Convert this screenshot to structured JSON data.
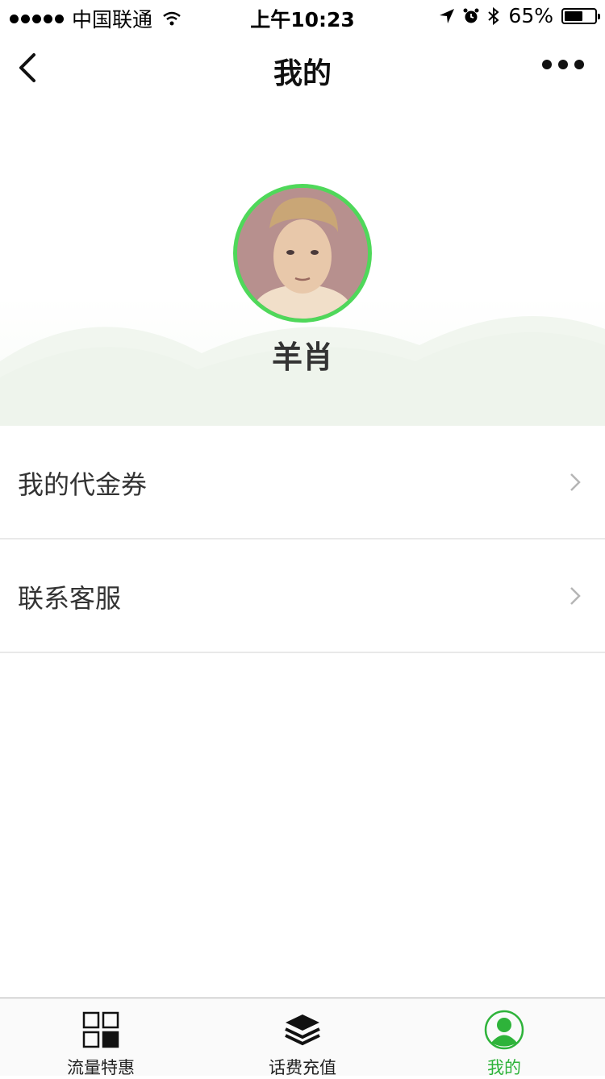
{
  "status_bar": {
    "carrier": "中国联通",
    "time": "上午10:23",
    "battery": "65%",
    "battery_level": 0.65,
    "icons": [
      "signal-dots",
      "wifi-icon",
      "location-arrow-icon",
      "alarm-icon",
      "bluetooth-icon",
      "battery-icon"
    ]
  },
  "nav": {
    "title": "我的",
    "back_icon": "chevron-left-icon",
    "more_icon": "more-dots-icon"
  },
  "profile": {
    "name": "羊肖",
    "avatar": "avatar-photo",
    "ring_color": "#4fd85a"
  },
  "menu": {
    "items": [
      {
        "label": "我的代金券",
        "icon": "chevron-right-icon"
      },
      {
        "label": "联系客服",
        "icon": "chevron-right-icon"
      }
    ]
  },
  "tabs": [
    {
      "label": "流量特惠",
      "icon": "grid-icon",
      "active": false
    },
    {
      "label": "话费充值",
      "icon": "layers-icon",
      "active": false
    },
    {
      "label": "我的",
      "icon": "user-circle-icon",
      "active": true
    }
  ],
  "colors": {
    "accent": "#2eb33a",
    "text": "#333333",
    "divider": "#e9e9e9"
  }
}
